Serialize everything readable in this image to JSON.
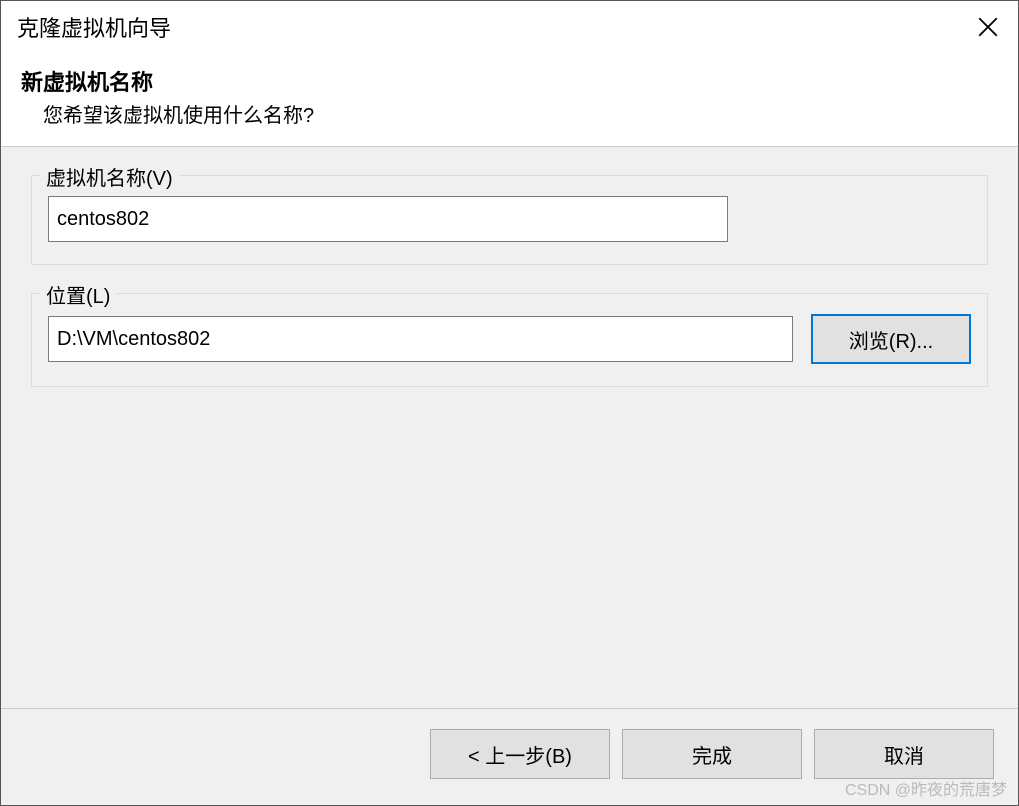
{
  "titlebar": {
    "title": "克隆虚拟机向导"
  },
  "header": {
    "title": "新虚拟机名称",
    "subtitle": "您希望该虚拟机使用什么名称?"
  },
  "form": {
    "name": {
      "legend": "虚拟机名称(V)",
      "value": "centos802"
    },
    "location": {
      "legend": "位置(L)",
      "value": "D:\\VM\\centos802",
      "browse_label": "浏览(R)..."
    }
  },
  "footer": {
    "back_label": "< 上一步(B)",
    "finish_label": "完成",
    "cancel_label": "取消"
  },
  "watermark": "CSDN @昨夜的荒唐梦"
}
